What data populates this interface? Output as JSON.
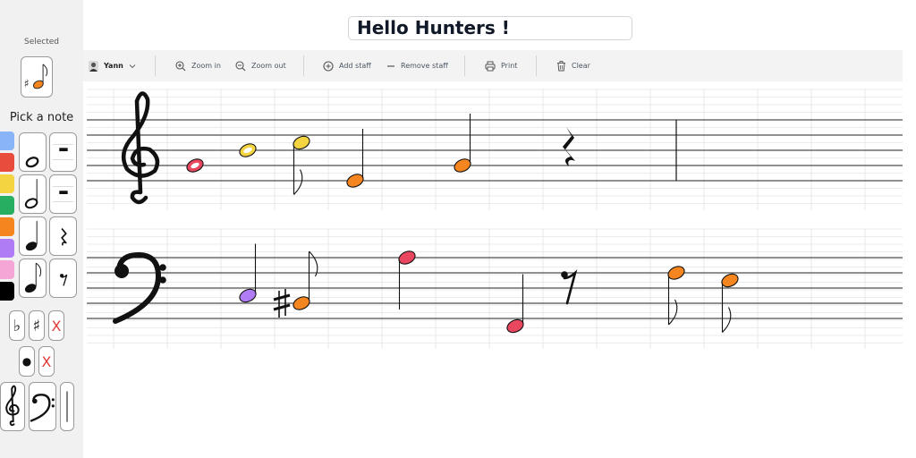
{
  "sidebar": {
    "selected_label": "Selected",
    "pick_label": "Pick a note",
    "palette": [
      "#8ab4f8",
      "#e74c3c",
      "#f5d442",
      "#27ae60",
      "#f5861f",
      "#b07cf5",
      "#f5a6d6",
      "#000000"
    ],
    "accidentals": {
      "flat": "♭",
      "sharp": "♯",
      "remove": "X"
    },
    "dot": {
      "dot": "●",
      "remove": "X"
    },
    "selected_note_color": "#f5861f"
  },
  "header": {
    "title": "Hello Hunters !"
  },
  "toolbar": {
    "user": "Yann",
    "zoom_in": "Zoom in",
    "zoom_out": "Zoom out",
    "add_staff": "Add staff",
    "remove_staff": "Remove staff",
    "print": "Print",
    "clear": "Clear"
  },
  "colors": {
    "red": "#e8475f",
    "yellow": "#f5d442",
    "orange": "#f5861f",
    "purple": "#b07cf5",
    "toolbar_bg": "#f3f3f3",
    "sidebar_bg": "#f1f1f1"
  },
  "score": {
    "treble": {
      "clef": "treble",
      "notes": [
        {
          "kind": "whole",
          "color": "#e8475f",
          "pitch": "G4"
        },
        {
          "kind": "whole",
          "color": "#f5d442",
          "pitch": "B4"
        },
        {
          "kind": "eighth",
          "color": "#f5d442",
          "pitch": "C5",
          "stem": "down"
        },
        {
          "kind": "half",
          "color": "#f5861f",
          "pitch": "E4",
          "stem": "up"
        },
        {
          "kind": "half",
          "color": "#f5861f",
          "pitch": "G4",
          "stem": "up"
        },
        {
          "kind": "quarter-rest"
        }
      ]
    },
    "bass": {
      "clef": "bass",
      "notes": [
        {
          "kind": "half",
          "color": "#b07cf5",
          "pitch": "C3",
          "stem": "up"
        },
        {
          "kind": "eighth",
          "color": "#f5861f",
          "pitch": "B2",
          "stem": "up",
          "accidental": "sharp"
        },
        {
          "kind": "half",
          "color": "#e8475f",
          "pitch": "A3",
          "stem": "down"
        },
        {
          "kind": "half",
          "color": "#e8475f",
          "pitch": "F2",
          "stem": "up"
        },
        {
          "kind": "eighth-rest"
        },
        {
          "kind": "eighth",
          "color": "#f5861f",
          "pitch": "F3",
          "stem": "down"
        },
        {
          "kind": "eighth",
          "color": "#f5861f",
          "pitch": "E3",
          "stem": "down"
        }
      ]
    }
  }
}
